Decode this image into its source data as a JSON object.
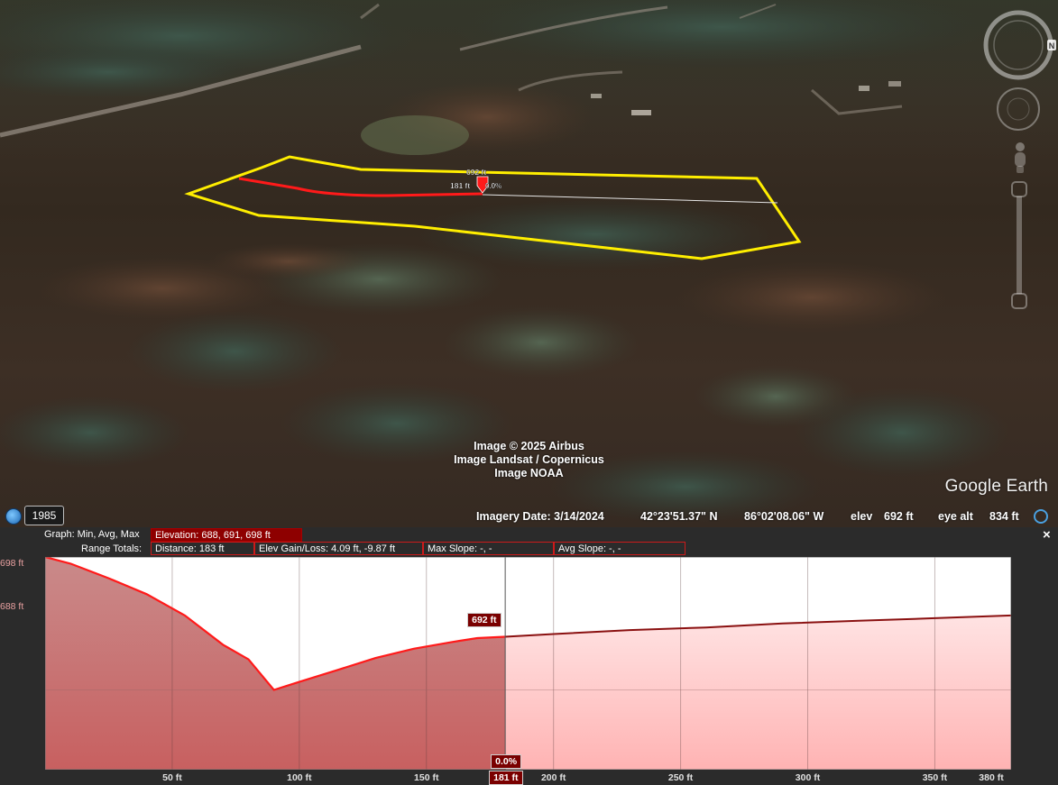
{
  "map": {
    "attribution": [
      "Image © 2025 Airbus",
      "Image Landsat / Copernicus",
      "Image NOAA"
    ],
    "logo": "Google Earth",
    "path_labels": {
      "elevation": "692 ft",
      "distance": "181 ft",
      "slope": "0.0%"
    },
    "colors": {
      "polygon": "#ffee00",
      "path": "#ff1a1a"
    }
  },
  "status": {
    "historical_year": "1985",
    "imagery_date": "Imagery Date: 3/14/2024",
    "lat": "42°23'51.37\" N",
    "lon": "86°02'08.06\" W",
    "elev_label": "elev",
    "elev_value": "692 ft",
    "eye_alt_label": "eye alt",
    "eye_alt_value": "834 ft"
  },
  "profile": {
    "graph_label": "Graph: Min, Avg, Max",
    "elevation": "Elevation: 688, 691, 698 ft",
    "range_label": "Range Totals:",
    "distance": "Distance: 183 ft",
    "elev_gain_loss": "Elev Gain/Loss: 4.09 ft, -9.87 ft",
    "max_slope": "Max Slope: -, -",
    "avg_slope": "Avg Slope: -, -",
    "close": "×",
    "y_axis": [
      "698 ft",
      "688 ft"
    ],
    "x_axis": [
      "50 ft",
      "100 ft",
      "150 ft",
      "200 ft",
      "250 ft",
      "300 ft",
      "350 ft",
      "380 ft"
    ],
    "cursor": {
      "elevation": "692 ft",
      "slope": "0.0%",
      "distance": "181 ft"
    }
  },
  "chart_data": {
    "type": "area",
    "xlabel": "",
    "ylabel": "",
    "xlim": [
      0,
      380
    ],
    "ylim": [
      682,
      698
    ],
    "x_ticks": [
      50,
      100,
      150,
      200,
      250,
      300,
      350,
      380
    ],
    "y_ticks": [
      688,
      698
    ],
    "series": [
      {
        "x": [
          0,
          10,
          25,
          40,
          55,
          70,
          80,
          90,
          100,
          115,
          130,
          145,
          160,
          170,
          181,
          200,
          230,
          260,
          290,
          320,
          350,
          380
        ],
        "values": [
          698,
          697.5,
          696.4,
          695.2,
          693.6,
          691.4,
          690.3,
          688.0,
          688.6,
          689.5,
          690.4,
          691.1,
          691.6,
          691.9,
          692.0,
          692.2,
          692.5,
          692.7,
          693.0,
          693.2,
          693.4,
          693.6
        ]
      }
    ],
    "cursor_x": 181
  }
}
